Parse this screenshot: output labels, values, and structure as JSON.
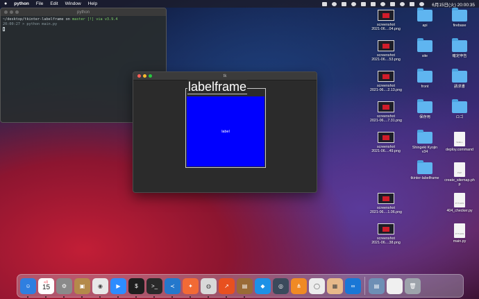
{
  "menubar": {
    "app_name": "python",
    "menus": [
      "File",
      "Edit",
      "Window",
      "Help"
    ],
    "clock": "6月15日(火) 20:00:35"
  },
  "terminal": {
    "title": "python",
    "line1_path": "~/desktop/tkinter-labelframe on ",
    "line1_branch": "master [!] via ",
    "line1_version": "v3.9.4",
    "line2": "20:00:27 > python main.py"
  },
  "tk_window": {
    "title": "tk",
    "labelframe_text": "labelframe",
    "label_text": "label",
    "label_bg": "#0000ff"
  },
  "desktop_icons": [
    {
      "kind": "thumb",
      "line1": "screenshot",
      "line2": "2021-06....04.png"
    },
    {
      "kind": "folder",
      "line1": "api",
      "line2": ""
    },
    {
      "kind": "folder",
      "line1": "firebase",
      "line2": ""
    },
    {
      "kind": "thumb",
      "line1": "screenshot",
      "line2": "2021-06....53.png"
    },
    {
      "kind": "folder",
      "line1": "site",
      "line2": ""
    },
    {
      "kind": "folder",
      "line1": "確定申告",
      "line2": ""
    },
    {
      "kind": "thumb",
      "line1": "screenshot",
      "line2": "2021-06....2.13.png"
    },
    {
      "kind": "folder",
      "line1": "front",
      "line2": ""
    },
    {
      "kind": "folder",
      "line1": "請求書",
      "line2": ""
    },
    {
      "kind": "thumb",
      "line1": "screenshot",
      "line2": "2021-06....7.31.png"
    },
    {
      "kind": "folder",
      "line1": "保存用",
      "line2": ""
    },
    {
      "kind": "folder",
      "line1": "ロゴ",
      "line2": ""
    },
    {
      "kind": "thumb",
      "line1": "screenshot",
      "line2": "2021-06....49.png"
    },
    {
      "kind": "folder",
      "line1": "Shingeki Kyojin",
      "line2": "v34"
    },
    {
      "kind": "doc",
      "line1": "deploy.command",
      "line2": "",
      "tag": "SHELL"
    },
    {
      "kind": "folder",
      "line1": "tkinter-labelframe",
      "line2": ""
    },
    {
      "kind": "doc",
      "line1": "create_sitemap.ph",
      "line2": "p",
      "tag": "PHP"
    },
    {
      "kind": "thumb",
      "line1": "screenshot",
      "line2": "2021-06....1.06.png"
    },
    {
      "kind": "doc",
      "line1": "404_checker.py",
      "line2": "",
      "tag": "PYTHON"
    },
    {
      "kind": "thumb",
      "line1": "screenshot",
      "line2": "2021-06....38.png"
    },
    {
      "kind": "doc",
      "line1": "main.py",
      "line2": "",
      "tag": "PYTHON"
    }
  ],
  "calendar": {
    "month": "6月",
    "day": "15"
  },
  "dock_apps": [
    {
      "name": "finder-icon",
      "color": "#2f7fe0",
      "glyph": "☺"
    },
    {
      "name": "calendar-icon",
      "color": "#ffffff",
      "glyph": ""
    },
    {
      "name": "system-preferences-icon",
      "color": "#8a8a8a",
      "glyph": "⚙"
    },
    {
      "name": "contacts-icon",
      "color": "#b48a4a",
      "glyph": "▣"
    },
    {
      "name": "chrome-icon",
      "color": "#e8e8e8",
      "glyph": "◉"
    },
    {
      "name": "zoom-icon",
      "color": "#2d8cff",
      "glyph": "▶"
    },
    {
      "name": "terminal-icon",
      "color": "#1e1e1e",
      "glyph": "$"
    },
    {
      "name": "terminal-2-icon",
      "color": "#2a2a2a",
      "glyph": ">_"
    },
    {
      "name": "vscode-icon",
      "color": "#2478cc",
      "glyph": "≺"
    },
    {
      "name": "safari-icon",
      "color": "#f26a35",
      "glyph": "✦"
    },
    {
      "name": "sequel-pro-icon",
      "color": "#d9d9d9",
      "glyph": "◍"
    },
    {
      "name": "activity-icon",
      "color": "#e8501f",
      "glyph": "↗"
    },
    {
      "name": "keka-icon",
      "color": "#9a6b36",
      "glyph": "▤"
    },
    {
      "name": "docker-icon",
      "color": "#1d91e6",
      "glyph": "◆"
    },
    {
      "name": "git-client-icon",
      "color": "#3b4a5c",
      "glyph": "◎"
    },
    {
      "name": "sourcetree-icon",
      "color": "#f08a24",
      "glyph": "⋔"
    },
    {
      "name": "network-icon",
      "color": "#ececec",
      "glyph": "◯"
    },
    {
      "name": "preview-icon",
      "color": "#e7b98a",
      "glyph": "▦"
    },
    {
      "name": "infinity-icon",
      "color": "#1977d6",
      "glyph": "∞"
    }
  ],
  "dock_right": [
    {
      "name": "screenshots-folder-icon",
      "color": "#6d8fb5",
      "glyph": "▤"
    },
    {
      "name": "documents-stack-icon",
      "color": "#f0f0f0",
      "glyph": ""
    },
    {
      "name": "trash-icon",
      "color": "#9da3ab",
      "glyph": "🗑"
    }
  ]
}
